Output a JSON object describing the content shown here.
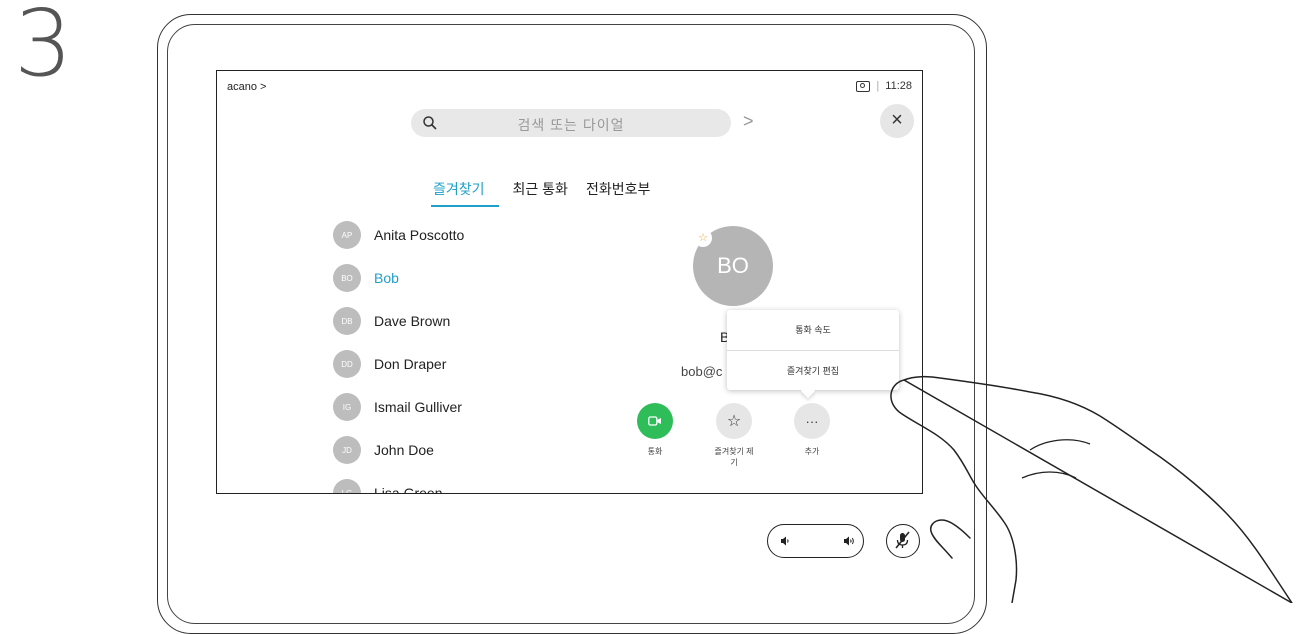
{
  "step_number": "3",
  "screen": {
    "breadcrumb": "acano >",
    "time": "11:28",
    "time_separator": "|",
    "search": {
      "placeholder": "검색 또는 다이얼",
      "next_label": ">"
    },
    "close_label": "×",
    "tabs": [
      {
        "label": "즐겨찾기",
        "active": true
      },
      {
        "label": "최근 통화",
        "active": false
      },
      {
        "label": "전화번호부",
        "active": false
      }
    ],
    "contacts": [
      {
        "initials": "AP",
        "name": "Anita Poscotto",
        "selected": false
      },
      {
        "initials": "BO",
        "name": "Bob",
        "selected": true
      },
      {
        "initials": "DB",
        "name": "Dave Brown",
        "selected": false
      },
      {
        "initials": "DD",
        "name": "Don Draper",
        "selected": false
      },
      {
        "initials": "IG",
        "name": "Ismail Gulliver",
        "selected": false
      },
      {
        "initials": "JD",
        "name": "John Doe",
        "selected": false
      },
      {
        "initials": "LG",
        "name": "Lisa Green",
        "selected": false
      }
    ],
    "detail": {
      "initials": "BO",
      "name": "B",
      "email": "bob@c",
      "favorite_star": "☆"
    },
    "menu": {
      "items": [
        "통화 속도",
        "즐겨찾기 편집"
      ]
    },
    "actions": {
      "call_label": "통화",
      "favorite_label": "즐겨찾기 제\n기",
      "more_label": "추가",
      "more_icon": "···",
      "favorite_icon": "☆"
    }
  },
  "colors": {
    "accent": "#1fa0c8",
    "call_green": "#2ebd59",
    "avatar_grey": "#bdbdbd",
    "star": "#f3a63a"
  }
}
